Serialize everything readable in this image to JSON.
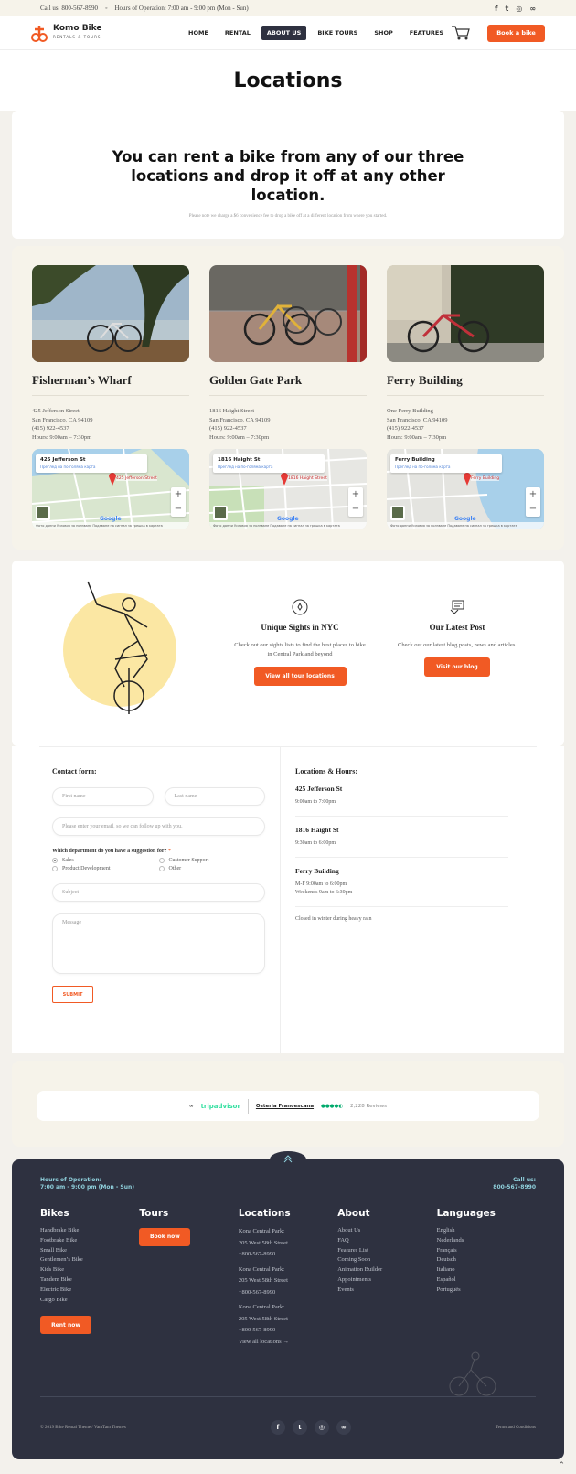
{
  "topbar": {
    "call": "Call us:  800-567-8990",
    "hours": "Hours of Operation: 7:00 am - 9:00 pm (Mon - Sun)",
    "social_icons": [
      "facebook-icon",
      "twitter-icon",
      "instagram-icon",
      "tripadvisor-icon"
    ]
  },
  "header": {
    "logo_name": "Komo Bike",
    "logo_sub": "RENTALS & TOURS",
    "nav": [
      "HOME",
      "RENTAL",
      "ABOUT US",
      "BIKE TOURS",
      "SHOP",
      "FEATURES"
    ],
    "active_nav": "ABOUT US",
    "book_button": "Book a bike",
    "accent": "#f15a24"
  },
  "page_title": "Locations",
  "intro": {
    "heading": "You can rent a bike from any of our three locations and drop it off at any other location.",
    "note": "Please note we charge a $6 convenience fee to drop a bike off at a different location from where you started."
  },
  "locations": [
    {
      "name": "Fisherman’s Wharf",
      "address1": "425 Jefferson Street",
      "address2": "San Francisco, CA 94109",
      "phone": "(415) 922-4537",
      "hours": "Hours: 9:00am – 7:30pm",
      "map_title": "425 Jefferson St",
      "map_pin": "425 Jefferson Street",
      "map_link": "Преглед на по-голяма карта",
      "map_footer": "Фото данни   Условия за ползване   Подаване на сигнал за грешка в картата"
    },
    {
      "name": "Golden Gate Park",
      "address1": "1816 Haight Street",
      "address2": "San Francisco, CA 94109",
      "phone": "(415) 922-4537",
      "hours": "Hours: 9:00am – 7:30pm",
      "map_title": "1816 Haight St",
      "map_pin": "1816 Haight Street",
      "map_link": "Преглед на по-голяма карта",
      "map_footer": "Фото данни   Условия за ползване   Подаване на сигнал за грешка в картата"
    },
    {
      "name": "Ferry Building",
      "address1": "One Ferry Building",
      "address2": "San Francisco, CA 94109",
      "phone": "(415) 922-4537",
      "hours": "Hours: 9:00am – 7:30pm",
      "map_title": "Ferry Building",
      "map_pin": "Ferry Building",
      "map_link": "Преглед на по-голяма карта",
      "map_footer": "Фото данни   Условия за ползване   Подаване на сигнал за грешка в картата"
    }
  ],
  "features": [
    {
      "icon": "map-pin-icon",
      "title": "Unique Sights in NYC",
      "text": "Check out our sights lists to find the best places to bike in Central Park and beyond",
      "button": "View all tour locations"
    },
    {
      "icon": "blog-post-icon",
      "title": "Our Latest Post",
      "text": "Check out our latest blog posts, news and articles.",
      "button": "Visit our blog"
    }
  ],
  "contact": {
    "title": "Contact form:",
    "first_name": "First name",
    "last_name": "Last name",
    "email": "Please enter your email, so we can follow up with you.",
    "question": "Which department do you have a suggestion for?",
    "required_mark": "*",
    "options": [
      "Sales",
      "Customer Support",
      "Product Development",
      "Other"
    ],
    "selected": "Sales",
    "subject": "Subject",
    "message": "Message",
    "submit": "SUBMIT"
  },
  "hours": {
    "title": "Locations & Hours:",
    "items": [
      {
        "name": "425 Jefferson St",
        "lines": [
          "9:00am to 7:00pm"
        ]
      },
      {
        "name": "1816 Haight St",
        "lines": [
          "9:30am to 6:00pm"
        ]
      },
      {
        "name": "Ferry Building",
        "lines": [
          "M-F 9:00am to 6:00pm",
          "Weekends 9am to 6:30pm"
        ]
      }
    ],
    "note": "Closed in winter during heavy rain"
  },
  "tripadvisor": {
    "brand": "tripadvisor",
    "place": "Osteria Francescana",
    "reviews": "2,228 Reviews"
  },
  "footer": {
    "hours_label": "Hours of Operation:",
    "hours_value": "7:00 am - 9:00 pm (Mon - Sun)",
    "call_label": "Call us:",
    "call_value": "800-567-8990",
    "bikes_title": "Bikes",
    "bikes": [
      "Handbrake Bike",
      "Footbrake Bike",
      "Small Bike",
      "Gentlemen’s Bike",
      "Kids Bike",
      "Tandem Bike",
      "Electric Bike",
      "Cargo Bike"
    ],
    "rent_button": "Rent now",
    "tours_title": "Tours",
    "tours_button": "Book now",
    "locations_title": "Locations",
    "locations": [
      {
        "name": "Kona Central Park:",
        "street": "205 West 58th Street",
        "phone": "+800-567-8990"
      },
      {
        "name": "Kona Central Park:",
        "street": "205 West 58th Street",
        "phone": "+800-567-8990"
      },
      {
        "name": "Kona Central Park:",
        "street": "205 West 58th Street",
        "phone": "+800-567-8990"
      }
    ],
    "view_all": "View all locations →",
    "about_title": "About",
    "about": [
      "About Us",
      "FAQ",
      "Features List",
      "Coming Soon",
      "Animation Builder",
      "Appointments",
      "Events"
    ],
    "languages_title": "Languages",
    "languages": [
      "English",
      "Nederlands",
      "Français",
      "Deutsch",
      "Italiano",
      "Español",
      "Português"
    ],
    "copyright": "© 2019 Bike Rental Theme / VamTam Themes",
    "terms": "Terms and Conditions",
    "social_icons": [
      "facebook-icon",
      "twitter-icon",
      "instagram-icon",
      "tripadvisor-icon"
    ],
    "background": "#2e3140",
    "accent_text": "#8fd0dc"
  }
}
